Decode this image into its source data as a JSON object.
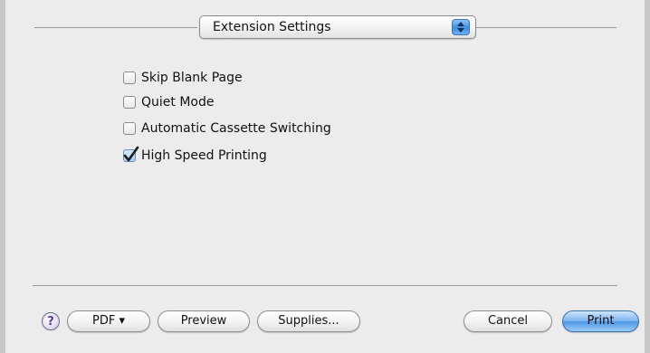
{
  "settings_popup": {
    "selected": "Extension Settings"
  },
  "options": [
    {
      "label": "Skip Blank Page",
      "checked": false
    },
    {
      "label": "Quiet Mode",
      "checked": false
    },
    {
      "label": "Automatic Cassette Switching",
      "checked": false
    },
    {
      "label": "High Speed Printing",
      "checked": true
    }
  ],
  "buttons": {
    "help": "?",
    "pdf": "PDF ▾",
    "preview": "Preview",
    "supplies": "Supplies...",
    "cancel": "Cancel",
    "print": "Print"
  },
  "colors": {
    "default_button": "#5a9fe8",
    "checked_box": "#a7cdf3",
    "dialog_background": "#ececec"
  },
  "icons": {
    "popup_arrows": "up-down-arrows-icon",
    "checkmark": "checkmark-icon",
    "help": "question-mark-icon"
  }
}
